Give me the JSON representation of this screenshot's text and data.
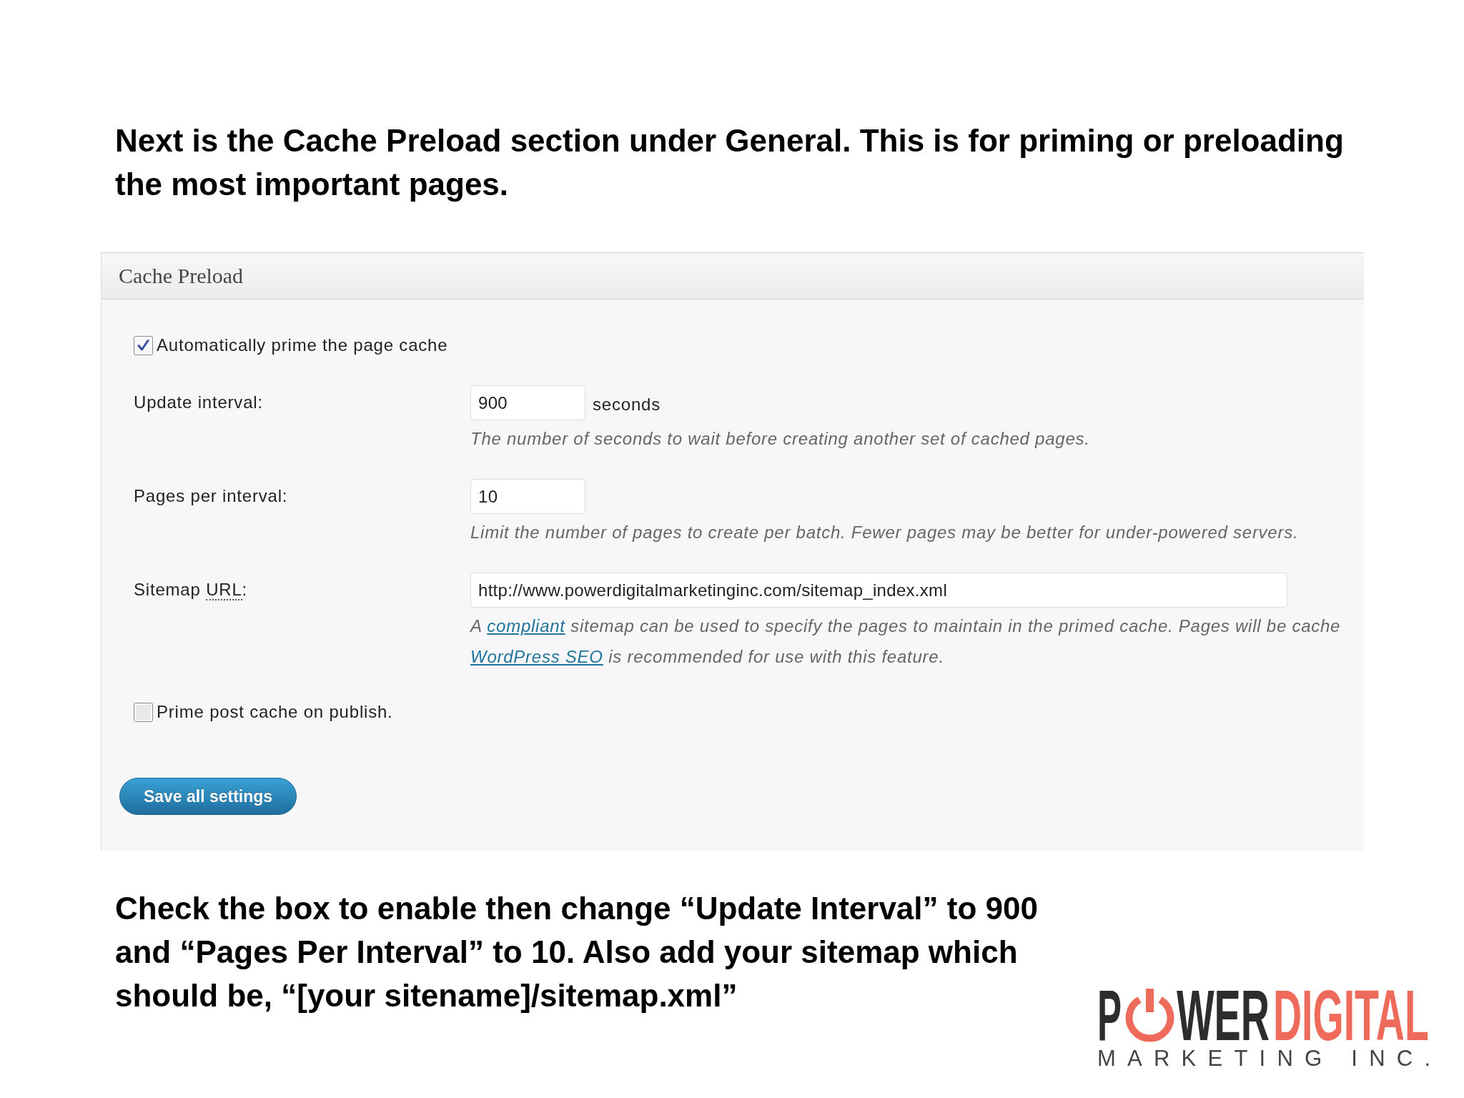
{
  "heading": "Next is the Cache Preload section under General. This is for priming or preloading the most important pages.",
  "panel": {
    "title": "Cache Preload",
    "rows": [
      {
        "kind": "checkbox",
        "label": "Automatically prime the page cache",
        "checked": true
      },
      {
        "kind": "number",
        "label": "Update interval:",
        "value": "900",
        "unit": "seconds",
        "help": [
          [
            {
              "kind": "text",
              "text": "The number of seconds to wait before creating another set of cached pages."
            }
          ]
        ]
      },
      {
        "kind": "number",
        "label": "Pages per interval:",
        "value": "10",
        "help": [
          [
            {
              "kind": "text",
              "text": "Limit the number of pages to create per batch. Fewer pages may be better for under-powered servers."
            }
          ]
        ]
      },
      {
        "kind": "url",
        "label": "Sitemap",
        "label_abbr": "URL",
        "label_end": ":",
        "value": "http://www.powerdigitalmarketinginc.com/sitemap_index.xml",
        "help": [
          [
            {
              "kind": "text",
              "text": "A"
            },
            {
              "kind": "link",
              "text": "compliant"
            },
            {
              "kind": "text",
              "text": "sitemap can be used to specify the pages to maintain in the primed cache. Pages will be cache"
            }
          ],
          [
            {
              "kind": "link",
              "text": "WordPress SEO"
            },
            {
              "kind": "text",
              "text": "is recommended for use with this feature."
            }
          ]
        ]
      },
      {
        "kind": "checkbox",
        "label": "Prime post cache on publish.",
        "checked": false
      }
    ],
    "save_button": "Save all settings"
  },
  "instructions": "Check the box to enable then change “Update Interval” to 900 and “Pages Per Interval” to 10. Also add your sitemap which should be, “[your sitename]/sitemap.xml”",
  "logo": {
    "name_start": "P",
    "name_middle": "WER",
    "name_accent": "DIGITAL",
    "tagline": "MARKETING INC."
  }
}
